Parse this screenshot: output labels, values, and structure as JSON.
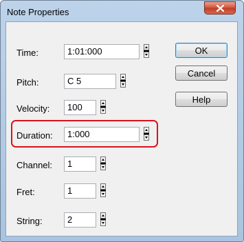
{
  "window": {
    "title": "Note Properties"
  },
  "fields": [
    {
      "label": "Time:",
      "value": "1:01:000"
    },
    {
      "label": "Pitch:",
      "value": "C 5"
    },
    {
      "label": "Velocity:",
      "value": "100"
    },
    {
      "label": "Duration:",
      "value": "1:000"
    },
    {
      "label": "Channel:",
      "value": "1"
    },
    {
      "label": "Fret:",
      "value": "1"
    },
    {
      "label": "String:",
      "value": "2"
    }
  ],
  "buttons": {
    "ok": "OK",
    "cancel": "Cancel",
    "help": "Help"
  },
  "colors": {
    "highlight": "#d9121c",
    "close_button": "#c23b22"
  }
}
